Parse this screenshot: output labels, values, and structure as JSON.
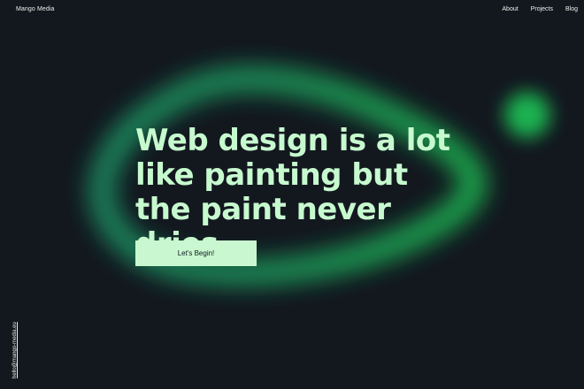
{
  "brand": {
    "name": "Mango Media"
  },
  "nav": {
    "items": [
      {
        "label": "About"
      },
      {
        "label": "Projects"
      },
      {
        "label": "Blog"
      }
    ]
  },
  "hero": {
    "headline": "Web design is a lot like painting but the paint never dries.",
    "cta_label": "Let's Begin!"
  },
  "contact": {
    "email": "hello@mango-media.eu"
  },
  "colors": {
    "background": "#13181f",
    "accent_green": "#1fbf5f",
    "headline": "#c7f9cf",
    "button_bg": "#c9f8d0"
  }
}
